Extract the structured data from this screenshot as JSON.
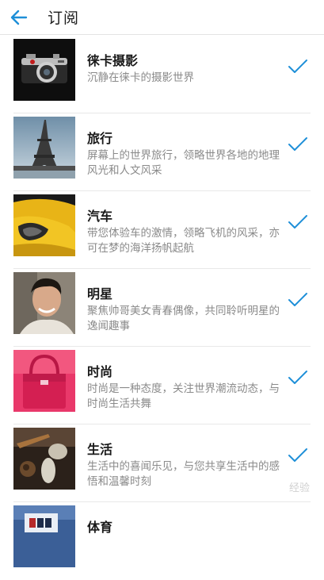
{
  "header": {
    "title": "订阅",
    "back_icon": "arrow-left-icon",
    "accent": "#1e8fd8"
  },
  "items": [
    {
      "name": "徕卡摄影",
      "desc": "沉静在徕卡的摄影世界",
      "subscribed": true
    },
    {
      "name": "旅行",
      "desc": "屏幕上的世界旅行，领略世界各地的地理风光和人文风采",
      "subscribed": true
    },
    {
      "name": "汽车",
      "desc": "带您体验车的激情，领略飞机的风采，亦可在梦的海洋扬帆起航",
      "subscribed": true
    },
    {
      "name": "明星",
      "desc": "聚焦帅哥美女青春偶像，共同聆听明星的逸闻趣事",
      "subscribed": true
    },
    {
      "name": "时尚",
      "desc": "时尚是一种态度，关注世界潮流动态，与时尚生活共舞",
      "subscribed": true
    },
    {
      "name": "生活",
      "desc": "生活中的喜闻乐见，与您共享生活中的感悟和温馨时刻",
      "subscribed": true
    },
    {
      "name": "体育",
      "desc": "",
      "subscribed": false
    }
  ],
  "watermark": "经验"
}
